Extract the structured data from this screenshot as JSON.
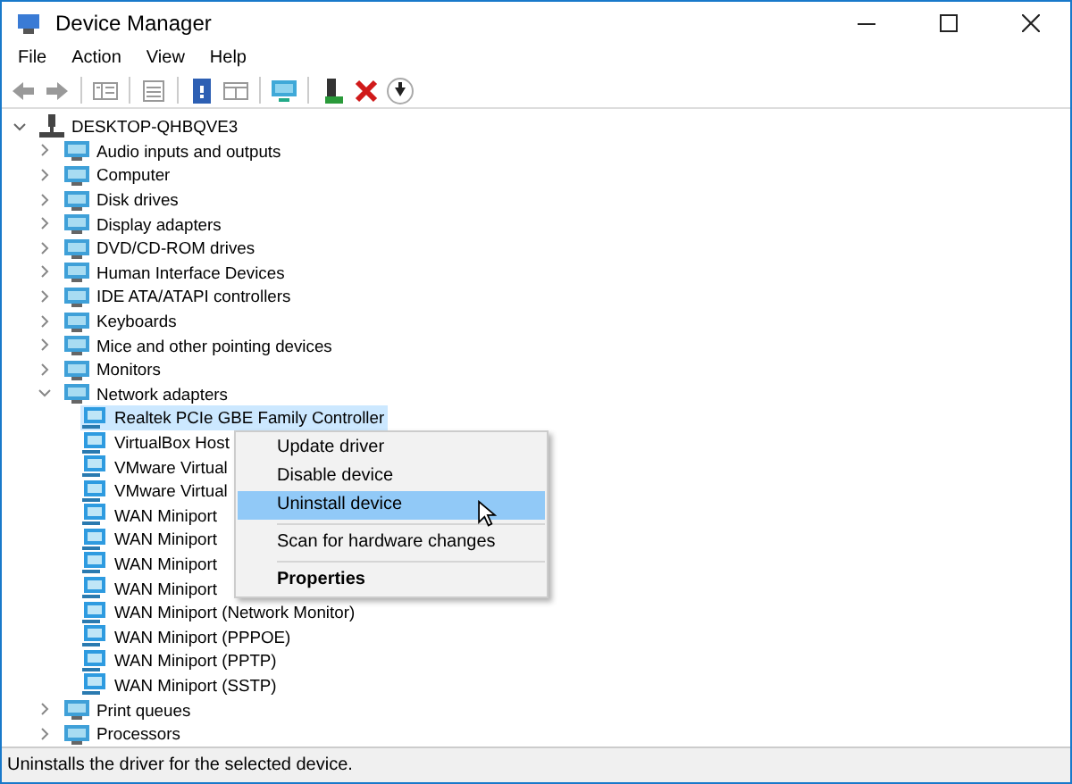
{
  "window": {
    "title": "Device Manager"
  },
  "menu": [
    "File",
    "Action",
    "View",
    "Help"
  ],
  "tree": {
    "label": "DESKTOP-QHBQVE3",
    "expanded": true,
    "children": [
      {
        "label": "Audio inputs and outputs",
        "expanded": false
      },
      {
        "label": "Computer",
        "expanded": false
      },
      {
        "label": "Disk drives",
        "expanded": false
      },
      {
        "label": "Display adapters",
        "expanded": false
      },
      {
        "label": "DVD/CD-ROM drives",
        "expanded": false
      },
      {
        "label": "Human Interface Devices",
        "expanded": false
      },
      {
        "label": "IDE ATA/ATAPI controllers",
        "expanded": false
      },
      {
        "label": "Keyboards",
        "expanded": false
      },
      {
        "label": "Mice and other pointing devices",
        "expanded": false
      },
      {
        "label": "Monitors",
        "expanded": false
      },
      {
        "label": "Network adapters",
        "expanded": true,
        "children": [
          {
            "label": "Realtek PCIe GBE Family Controller",
            "selected": true
          },
          {
            "label": "VirtualBox Host",
            "selected": false
          },
          {
            "label": "VMware Virtual",
            "selected": false
          },
          {
            "label": "VMware Virtual",
            "selected": false
          },
          {
            "label": "WAN Miniport",
            "selected": false
          },
          {
            "label": "WAN Miniport",
            "selected": false
          },
          {
            "label": "WAN Miniport",
            "selected": false
          },
          {
            "label": "WAN Miniport",
            "selected": false
          },
          {
            "label": "WAN Miniport (Network Monitor)",
            "selected": false
          },
          {
            "label": "WAN Miniport (PPPOE)",
            "selected": false
          },
          {
            "label": "WAN Miniport (PPTP)",
            "selected": false
          },
          {
            "label": "WAN Miniport (SSTP)",
            "selected": false
          }
        ]
      },
      {
        "label": "Print queues",
        "expanded": false
      },
      {
        "label": "Processors",
        "expanded": false
      }
    ]
  },
  "context_menu": [
    {
      "kind": "item",
      "label": "Update driver",
      "selected": false
    },
    {
      "kind": "item",
      "label": "Disable device",
      "selected": false
    },
    {
      "kind": "item",
      "label": "Uninstall device",
      "selected": true
    },
    {
      "kind": "separator"
    },
    {
      "kind": "item",
      "label": "Scan for hardware changes",
      "selected": false
    },
    {
      "kind": "separator"
    },
    {
      "kind": "default",
      "label": "Properties",
      "selected": false
    }
  ],
  "status_bar": "Uninstalls the driver for the selected device."
}
